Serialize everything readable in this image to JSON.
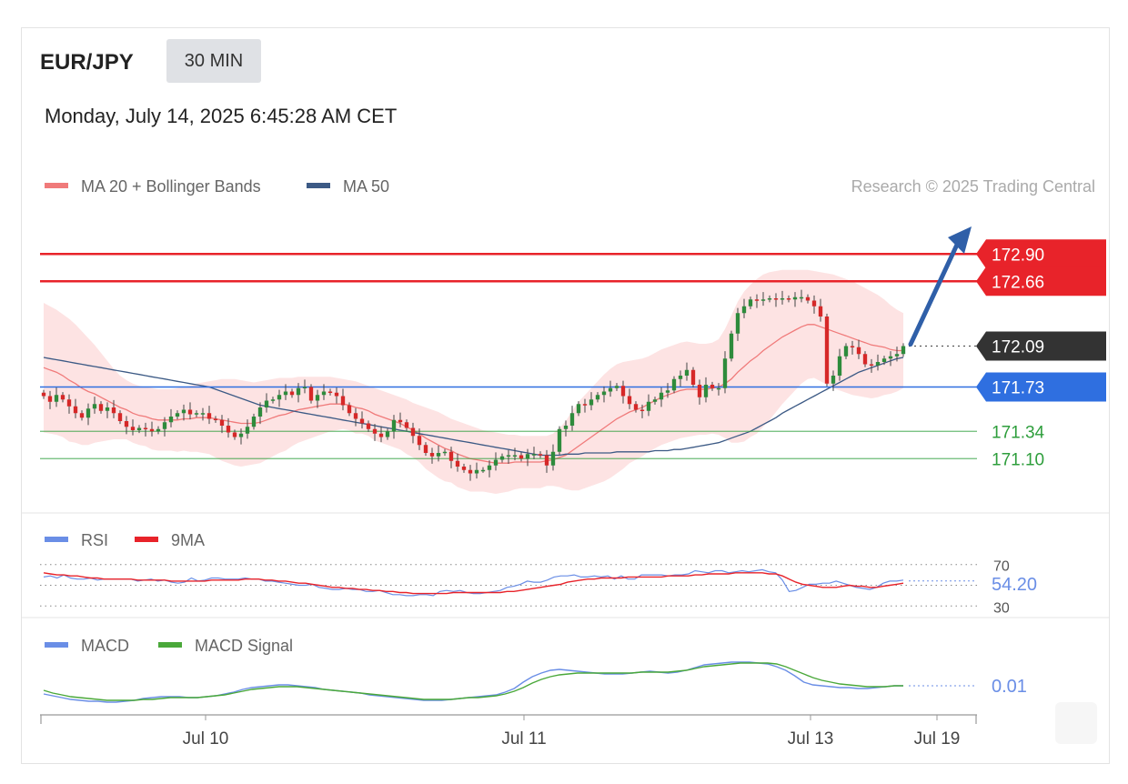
{
  "header": {
    "symbol": "EUR/JPY",
    "timeframe": "30 MIN",
    "datetime": "Monday, July 14, 2025 6:45:28 AM CET",
    "credit": "Research © 2025 Trading Central"
  },
  "colors": {
    "resistance": "#e8232a",
    "pivot": "#2f6fe0",
    "support": "#2e9e3c",
    "last_price": "#333333",
    "bollinger_fill": "#fde2e2",
    "ma20": "#f07a7a",
    "ma50": "#3c5a85",
    "candle_up": "#2e8b3c",
    "candle_down": "#d62828",
    "rsi": "#6a8ee6",
    "rsi_ma": "#e8232a",
    "macd": "#6a8ee6",
    "macd_signal": "#4aa83a",
    "arrow": "#2f5fa8"
  },
  "chart_data": [
    {
      "type": "candlestick",
      "legend": [
        {
          "name": "MA 20 + Bollinger Bands",
          "color": "#f07a7a"
        },
        {
          "name": "MA 50",
          "color": "#3c5a85"
        }
      ],
      "levels": [
        {
          "value": "172.90",
          "kind": "resistance"
        },
        {
          "value": "172.66",
          "kind": "resistance"
        },
        {
          "value": "172.09",
          "kind": "last"
        },
        {
          "value": "171.73",
          "kind": "pivot"
        },
        {
          "value": "171.34",
          "kind": "support"
        },
        {
          "value": "171.10",
          "kind": "support"
        }
      ],
      "x_ticks": [
        "Jul 10",
        "Jul 11",
        "Jul 13",
        "Jul 19"
      ],
      "ylim": [
        170.63,
        173.27
      ],
      "close": [
        171.65,
        171.6,
        171.66,
        171.62,
        171.56,
        171.5,
        171.46,
        171.54,
        171.58,
        171.52,
        171.55,
        171.5,
        171.43,
        171.38,
        171.35,
        171.37,
        171.36,
        171.34,
        171.36,
        171.42,
        171.47,
        171.5,
        171.53,
        171.49,
        171.5,
        171.5,
        171.45,
        171.44,
        171.39,
        171.33,
        171.29,
        171.32,
        171.38,
        171.47,
        171.55,
        171.61,
        171.62,
        171.66,
        171.69,
        171.66,
        171.72,
        171.73,
        171.61,
        171.66,
        171.69,
        171.68,
        171.65,
        171.57,
        171.5,
        171.45,
        171.41,
        171.36,
        171.32,
        171.29,
        171.34,
        171.44,
        171.42,
        171.37,
        171.3,
        171.22,
        171.15,
        171.12,
        171.15,
        171.16,
        171.08,
        171.03,
        171.0,
        170.97,
        171.0,
        171.0,
        171.04,
        171.09,
        171.12,
        171.13,
        171.13,
        171.1,
        171.14,
        171.14,
        171.13,
        171.04,
        171.16,
        171.36,
        171.39,
        171.5,
        171.58,
        171.57,
        171.62,
        171.66,
        171.69,
        171.72,
        171.74,
        171.65,
        171.58,
        171.53,
        171.52,
        171.6,
        171.62,
        171.68,
        171.7,
        171.8,
        171.83,
        171.88,
        171.75,
        171.64,
        171.75,
        171.72,
        171.72,
        171.98,
        172.2,
        172.38,
        172.44,
        172.5,
        172.49,
        172.5,
        172.51,
        172.5,
        172.51,
        172.5,
        172.52,
        172.52,
        172.49,
        172.44,
        172.35,
        171.76,
        171.83,
        172.0,
        172.09,
        172.08,
        172.02,
        171.93,
        171.92,
        171.95,
        171.98,
        172.0,
        172.02,
        172.09
      ],
      "ma20": [
        171.9,
        171.88,
        171.86,
        171.83,
        171.79,
        171.76,
        171.72,
        171.69,
        171.67,
        171.64,
        171.61,
        171.58,
        171.55,
        171.53,
        171.5,
        171.48,
        171.47,
        171.45,
        171.44,
        171.44,
        171.44,
        171.44,
        171.45,
        171.45,
        171.46,
        171.46,
        171.46,
        171.45,
        171.44,
        171.43,
        171.42,
        171.41,
        171.41,
        171.41,
        171.42,
        171.44,
        171.46,
        171.48,
        171.49,
        171.51,
        171.53,
        171.54,
        171.55,
        171.56,
        171.57,
        171.58,
        171.58,
        171.58,
        171.57,
        171.55,
        171.54,
        171.52,
        171.49,
        171.47,
        171.45,
        171.43,
        171.41,
        171.38,
        171.35,
        171.32,
        171.28,
        171.25,
        171.22,
        171.19,
        171.17,
        171.14,
        171.12,
        171.1,
        171.09,
        171.08,
        171.07,
        171.06,
        171.06,
        171.06,
        171.07,
        171.07,
        171.07,
        171.07,
        171.07,
        171.08,
        171.09,
        171.11,
        171.13,
        171.17,
        171.21,
        171.25,
        171.29,
        171.33,
        171.37,
        171.41,
        171.45,
        171.48,
        171.51,
        171.53,
        171.55,
        171.58,
        171.61,
        171.64,
        171.66,
        171.68,
        171.7,
        171.71,
        171.71,
        171.71,
        171.71,
        171.72,
        171.73,
        171.76,
        171.8,
        171.86,
        171.91,
        171.96,
        172.0,
        172.05,
        172.09,
        172.13,
        172.17,
        172.2,
        172.23,
        172.26,
        172.28,
        172.28,
        172.26,
        172.24,
        172.22,
        172.2,
        172.18,
        172.16,
        172.14,
        172.12,
        172.1,
        172.09,
        172.08,
        172.06,
        172.05,
        172.05
      ],
      "ma50": [
        171.99,
        171.98,
        171.97,
        171.96,
        171.95,
        171.94,
        171.93,
        171.92,
        171.91,
        171.9,
        171.89,
        171.88,
        171.87,
        171.86,
        171.85,
        171.84,
        171.83,
        171.82,
        171.81,
        171.8,
        171.79,
        171.78,
        171.77,
        171.76,
        171.75,
        171.74,
        171.73,
        171.71,
        171.69,
        171.67,
        171.65,
        171.63,
        171.61,
        171.59,
        171.57,
        171.56,
        171.55,
        171.54,
        171.53,
        171.52,
        171.51,
        171.5,
        171.49,
        171.48,
        171.47,
        171.46,
        171.45,
        171.44,
        171.43,
        171.42,
        171.41,
        171.4,
        171.39,
        171.38,
        171.37,
        171.36,
        171.35,
        171.34,
        171.33,
        171.32,
        171.31,
        171.3,
        171.29,
        171.28,
        171.27,
        171.26,
        171.25,
        171.24,
        171.23,
        171.22,
        171.21,
        171.2,
        171.19,
        171.18,
        171.17,
        171.16,
        171.15,
        171.14,
        171.13,
        171.13,
        171.13,
        171.13,
        171.14,
        171.14,
        171.14,
        171.15,
        171.15,
        171.15,
        171.15,
        171.15,
        171.16,
        171.16,
        171.16,
        171.16,
        171.16,
        171.16,
        171.17,
        171.17,
        171.17,
        171.18,
        171.18,
        171.19,
        171.2,
        171.21,
        171.22,
        171.23,
        171.24,
        171.26,
        171.28,
        171.3,
        171.32,
        171.34,
        171.37,
        171.4,
        171.43,
        171.46,
        171.5,
        171.53,
        171.56,
        171.59,
        171.62,
        171.65,
        171.68,
        171.71,
        171.74,
        171.77,
        171.8,
        171.83,
        171.86,
        171.88,
        171.9,
        171.92,
        171.94,
        171.96,
        171.98,
        171.99
      ],
      "bb_upper": [
        172.47,
        172.44,
        172.41,
        172.37,
        172.33,
        172.28,
        172.22,
        172.16,
        172.1,
        172.03,
        171.96,
        171.89,
        171.83,
        171.79,
        171.76,
        171.74,
        171.73,
        171.72,
        171.71,
        171.71,
        171.71,
        171.72,
        171.73,
        171.74,
        171.76,
        171.77,
        171.78,
        171.79,
        171.8,
        171.8,
        171.8,
        171.79,
        171.78,
        171.77,
        171.78,
        171.79,
        171.8,
        171.81,
        171.81,
        171.81,
        171.82,
        171.82,
        171.82,
        171.82,
        171.82,
        171.82,
        171.81,
        171.8,
        171.79,
        171.78,
        171.76,
        171.74,
        171.72,
        171.7,
        171.68,
        171.66,
        171.64,
        171.62,
        171.59,
        171.57,
        171.55,
        171.53,
        171.51,
        171.48,
        171.45,
        171.43,
        171.41,
        171.39,
        171.37,
        171.35,
        171.34,
        171.33,
        171.32,
        171.31,
        171.31,
        171.3,
        171.3,
        171.3,
        171.3,
        171.3,
        171.32,
        171.37,
        171.43,
        171.52,
        171.6,
        171.66,
        171.72,
        171.78,
        171.84,
        171.89,
        171.93,
        171.95,
        171.96,
        171.97,
        171.98,
        172.0,
        172.03,
        172.06,
        172.08,
        172.1,
        172.12,
        172.13,
        172.12,
        172.11,
        172.11,
        172.12,
        172.15,
        172.24,
        172.36,
        172.48,
        172.57,
        172.63,
        172.68,
        172.72,
        172.74,
        172.75,
        172.76,
        172.76,
        172.76,
        172.76,
        172.76,
        172.75,
        172.74,
        172.73,
        172.72,
        172.7,
        172.68,
        172.66,
        172.63,
        172.6,
        172.57,
        172.54,
        172.5,
        172.45,
        172.41,
        172.38
      ],
      "bb_lower": [
        171.33,
        171.32,
        171.31,
        171.29,
        171.25,
        171.24,
        171.22,
        171.22,
        171.24,
        171.25,
        171.26,
        171.27,
        171.27,
        171.27,
        171.24,
        171.22,
        171.21,
        171.18,
        171.17,
        171.17,
        171.17,
        171.16,
        171.17,
        171.16,
        171.16,
        171.15,
        171.14,
        171.11,
        171.08,
        171.06,
        171.04,
        171.03,
        171.04,
        171.05,
        171.06,
        171.09,
        171.12,
        171.15,
        171.17,
        171.21,
        171.24,
        171.26,
        171.28,
        171.3,
        171.32,
        171.34,
        171.35,
        171.36,
        171.35,
        171.32,
        171.32,
        171.3,
        171.26,
        171.24,
        171.22,
        171.2,
        171.18,
        171.14,
        171.11,
        171.07,
        171.01,
        170.97,
        170.93,
        170.9,
        170.89,
        170.85,
        170.83,
        170.81,
        170.81,
        170.81,
        170.8,
        170.79,
        170.8,
        170.81,
        170.83,
        170.84,
        170.84,
        170.84,
        170.84,
        170.86,
        170.86,
        170.85,
        170.83,
        170.82,
        170.82,
        170.84,
        170.86,
        170.88,
        170.9,
        170.93,
        170.97,
        171.01,
        171.06,
        171.09,
        171.12,
        171.16,
        171.19,
        171.22,
        171.24,
        171.26,
        171.28,
        171.29,
        171.3,
        171.31,
        171.31,
        171.32,
        171.31,
        171.28,
        171.24,
        171.24,
        171.25,
        171.29,
        171.32,
        171.38,
        171.44,
        171.51,
        171.58,
        171.64,
        171.7,
        171.76,
        171.8,
        171.81,
        171.78,
        171.75,
        171.72,
        171.7,
        171.68,
        171.66,
        171.65,
        171.64,
        171.63,
        171.64,
        171.66,
        171.67,
        171.69,
        171.72
      ]
    },
    {
      "type": "line",
      "legend": [
        {
          "name": "RSI",
          "color": "#6a8ee6"
        },
        {
          "name": "9MA",
          "color": "#e8232a"
        }
      ],
      "levels": [
        "70",
        "30"
      ],
      "last_value": "54.20",
      "ylim": [
        25,
        75
      ],
      "rsi": [
        58,
        59,
        57,
        60,
        57,
        56,
        56,
        57,
        55,
        56,
        56,
        56,
        56,
        56,
        54,
        55,
        56,
        54,
        55,
        53,
        52,
        53,
        57,
        54,
        55,
        57,
        57,
        56,
        56,
        56,
        57,
        56,
        56,
        54,
        54,
        53,
        52,
        51,
        50,
        50,
        51,
        48,
        47,
        46,
        46,
        47,
        46,
        46,
        44,
        44,
        45,
        43,
        41,
        41,
        40,
        40,
        41,
        41,
        40,
        44,
        45,
        44,
        45,
        43,
        42,
        42,
        43,
        44,
        45,
        48,
        49,
        51,
        54,
        53,
        53,
        55,
        58,
        59,
        59,
        60,
        58,
        58,
        59,
        58,
        59,
        56,
        59,
        56,
        56,
        60,
        60,
        60,
        60,
        59,
        60,
        60,
        61,
        64,
        63,
        62,
        64,
        64,
        62,
        63,
        64,
        63,
        64,
        65,
        63,
        62,
        55,
        44,
        45,
        48,
        51,
        51,
        52,
        52,
        54,
        52,
        50,
        48,
        47,
        46,
        48,
        52,
        54,
        54,
        55
      ],
      "rsi_ma": [
        62,
        61,
        60,
        60,
        59,
        59,
        58,
        57,
        57,
        56,
        56,
        56,
        56,
        56,
        55,
        55,
        55,
        55,
        55,
        54,
        54,
        54,
        54,
        54,
        54,
        55,
        55,
        55,
        55,
        55,
        56,
        56,
        56,
        55,
        55,
        54,
        54,
        53,
        52,
        52,
        51,
        50,
        49,
        48,
        48,
        47,
        47,
        46,
        46,
        45,
        45,
        44,
        44,
        43,
        43,
        42,
        42,
        42,
        42,
        42,
        42,
        43,
        43,
        43,
        43,
        43,
        43,
        43,
        43,
        44,
        44,
        45,
        46,
        47,
        48,
        49,
        50,
        51,
        53,
        54,
        55,
        56,
        56,
        57,
        57,
        57,
        57,
        58,
        58,
        58,
        58,
        58,
        58,
        59,
        59,
        59,
        59,
        60,
        60,
        61,
        61,
        61,
        61,
        62,
        62,
        62,
        62,
        62,
        61,
        61,
        59,
        56,
        53,
        51,
        50,
        49,
        48,
        48,
        48,
        49,
        50,
        49,
        49,
        48,
        48,
        49,
        50,
        51,
        52
      ]
    },
    {
      "type": "line",
      "legend": [
        {
          "name": "MACD",
          "color": "#6a8ee6"
        },
        {
          "name": "MACD Signal",
          "color": "#4aa83a"
        }
      ],
      "last_value": "0.01",
      "ylim": [
        -0.35,
        0.35
      ],
      "macd": [
        -0.08,
        -0.1,
        -0.12,
        -0.14,
        -0.15,
        -0.16,
        -0.16,
        -0.17,
        -0.17,
        -0.16,
        -0.15,
        -0.13,
        -0.12,
        -0.11,
        -0.11,
        -0.11,
        -0.12,
        -0.12,
        -0.11,
        -0.1,
        -0.08,
        -0.06,
        -0.03,
        -0.01,
        0.0,
        0.01,
        0.02,
        0.02,
        0.01,
        0.0,
        -0.01,
        -0.03,
        -0.04,
        -0.05,
        -0.06,
        -0.07,
        -0.09,
        -0.1,
        -0.11,
        -0.12,
        -0.13,
        -0.14,
        -0.15,
        -0.15,
        -0.15,
        -0.14,
        -0.13,
        -0.12,
        -0.11,
        -0.1,
        -0.09,
        -0.06,
        -0.02,
        0.05,
        0.11,
        0.15,
        0.18,
        0.19,
        0.18,
        0.17,
        0.16,
        0.15,
        0.14,
        0.14,
        0.14,
        0.15,
        0.16,
        0.17,
        0.16,
        0.15,
        0.16,
        0.18,
        0.21,
        0.24,
        0.25,
        0.26,
        0.27,
        0.27,
        0.27,
        0.26,
        0.25,
        0.22,
        0.18,
        0.12,
        0.05,
        0.02,
        0.01,
        0.0,
        -0.01,
        -0.01,
        -0.02,
        -0.02,
        -0.01,
        0.0,
        0.01,
        0.01
      ],
      "signal": [
        -0.04,
        -0.07,
        -0.09,
        -0.11,
        -0.12,
        -0.13,
        -0.14,
        -0.15,
        -0.15,
        -0.15,
        -0.15,
        -0.14,
        -0.14,
        -0.13,
        -0.12,
        -0.12,
        -0.12,
        -0.12,
        -0.11,
        -0.1,
        -0.09,
        -0.07,
        -0.05,
        -0.03,
        -0.02,
        -0.01,
        0.0,
        0.0,
        0.0,
        -0.01,
        -0.02,
        -0.03,
        -0.04,
        -0.05,
        -0.06,
        -0.07,
        -0.08,
        -0.09,
        -0.1,
        -0.11,
        -0.12,
        -0.13,
        -0.14,
        -0.14,
        -0.14,
        -0.14,
        -0.13,
        -0.12,
        -0.12,
        -0.11,
        -0.1,
        -0.08,
        -0.05,
        -0.01,
        0.04,
        0.08,
        0.11,
        0.13,
        0.14,
        0.15,
        0.15,
        0.15,
        0.15,
        0.15,
        0.15,
        0.15,
        0.16,
        0.16,
        0.16,
        0.16,
        0.17,
        0.18,
        0.2,
        0.22,
        0.23,
        0.24,
        0.25,
        0.26,
        0.26,
        0.26,
        0.26,
        0.25,
        0.22,
        0.18,
        0.14,
        0.1,
        0.07,
        0.05,
        0.03,
        0.02,
        0.01,
        0.0,
        0.0,
        0.0,
        0.01,
        0.01
      ]
    }
  ]
}
